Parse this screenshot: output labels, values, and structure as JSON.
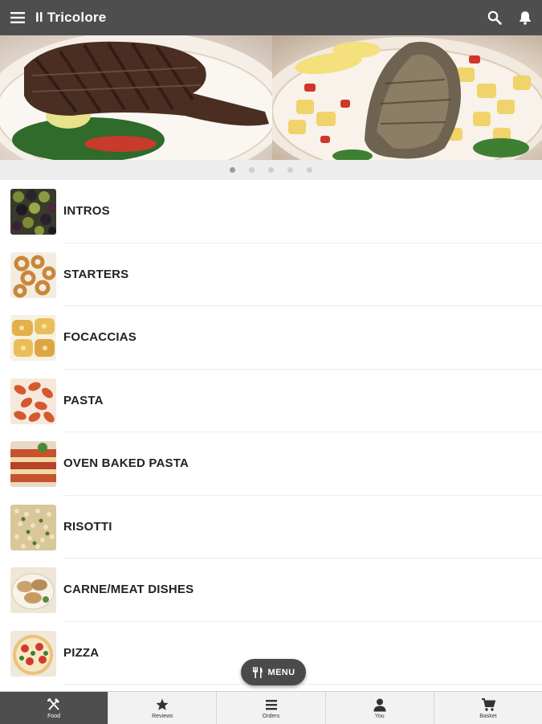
{
  "app": {
    "title": "Il Tricolore"
  },
  "banner": {
    "slides": [
      "Grilled steak",
      "Grilled fish"
    ],
    "active_index": 0,
    "count": 5
  },
  "categories": [
    {
      "label": "INTROS",
      "thumb": "olives"
    },
    {
      "label": "STARTERS",
      "thumb": "calamari"
    },
    {
      "label": "FOCACCIAS",
      "thumb": "garlic-bread"
    },
    {
      "label": "PASTA",
      "thumb": "pasta"
    },
    {
      "label": "OVEN BAKED PASTA",
      "thumb": "lasagna"
    },
    {
      "label": "RISOTTI",
      "thumb": "risotto"
    },
    {
      "label": "CARNE/MEAT DISHES",
      "thumb": "meat"
    },
    {
      "label": "PIZZA",
      "thumb": "pizza"
    }
  ],
  "fab": {
    "label": "MENU"
  },
  "nav": [
    {
      "label": "Food",
      "icon": "cutlery-icon",
      "active": true
    },
    {
      "label": "Reviews",
      "icon": "star-icon",
      "active": false
    },
    {
      "label": "Orders",
      "icon": "list-icon",
      "active": false
    },
    {
      "label": "You",
      "icon": "person-icon",
      "active": false
    },
    {
      "label": "Basket",
      "icon": "cart-icon",
      "active": false
    }
  ],
  "colors": {
    "appbar": "#4e4e4e",
    "active_tab": "#4e4e4e",
    "fab": "#4a4a4a"
  }
}
